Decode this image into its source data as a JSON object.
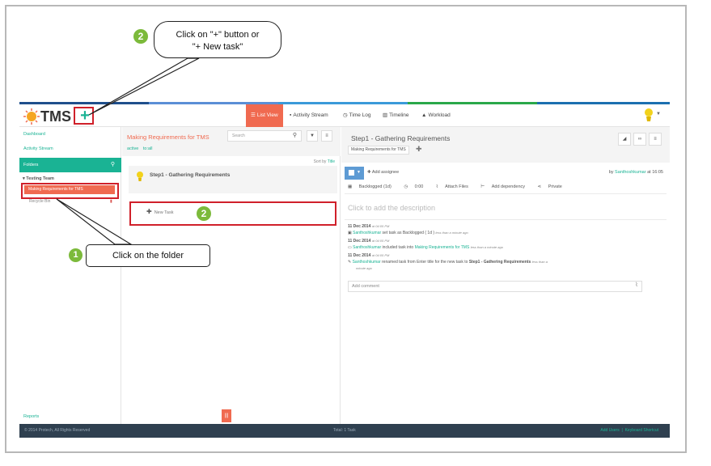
{
  "colors": {
    "accent": "#1ab394",
    "active": "#f06a50",
    "footer": "#2f4050",
    "callout_border": "#d0202a",
    "badge": "#7cba3b"
  },
  "header": {
    "logo_text": "TMS",
    "plus_label": "+",
    "tabs": [
      {
        "label": "List View",
        "icon": "list-icon",
        "active": true
      },
      {
        "label": "Activity Stream",
        "icon": "comment-icon",
        "active": false
      },
      {
        "label": "Time Log",
        "icon": "clock-icon",
        "active": false
      },
      {
        "label": "Timeline",
        "icon": "chart-icon",
        "active": false
      },
      {
        "label": "Workload",
        "icon": "user-icon",
        "active": false
      }
    ]
  },
  "sidebar": {
    "dashboard": "Dashboard",
    "activity_stream": "Activity Stream",
    "folders_label": "Folders",
    "team_label": "▾ Testing Team",
    "active_folder": "Making Requirements for TMS",
    "recycle_bin": "Recycle Bin",
    "reports": "Reports"
  },
  "list_panel": {
    "title": "Making Requirements for TMS",
    "filters": [
      "active",
      "to:all"
    ],
    "search_placeholder": "Search",
    "sort_label": "Sort by",
    "sort_value": "Title",
    "task_name": "Step1 - Gathering Requirements",
    "new_task": "New Task"
  },
  "detail": {
    "title": "Step1 - Gathering Requirements",
    "folder_chip": "Making Requirements for TMS",
    "add_assignee": "Add assignee",
    "by_prefix": "by",
    "by_user": "Santhoshkumar",
    "by_time": "at 16:05",
    "meta": {
      "status": "Backlogged (1d)",
      "time": "0:00",
      "attach": "Attach Files",
      "dependency": "Add dependency",
      "privacy": "Private"
    },
    "description_placeholder": "Click to add the description",
    "activity": [
      {
        "date": "11 Dec 2014",
        "time": "at 04:05 PM",
        "user": "Santhoshkumar",
        "text": "set task as Backlogged ( 1d )",
        "ago": "less than a minute ago"
      },
      {
        "date": "11 Dec 2014",
        "time": "at 04:05 PM",
        "user": "Santhoshkumar",
        "text": "included task into",
        "link": "Making Requirements for TMS",
        "ago": "less than a minute ago"
      },
      {
        "date": "11 Dec 2014",
        "time": "at 04:05 PM",
        "user": "Santhoshkumar",
        "text": "renamed task from Enter title for the new task to",
        "bold": "Step1 - Gathering Requirements",
        "ago": "less than a",
        "ago2": "minute ago"
      }
    ],
    "comment_placeholder": "Add comment"
  },
  "footer": {
    "copyright": "© 2014 Protech, All Rights Reserved",
    "total": "Total: 1 Task",
    "add_users": "Add Users",
    "divider": "|",
    "shortcut": "Keyboard Shortcut"
  },
  "callouts": {
    "top_text_1": "Click on \"+\" button or",
    "top_text_2": "\"+ New task\"",
    "bottom_text": "Click on the folder",
    "badge_1": "1",
    "badge_2": "2"
  }
}
